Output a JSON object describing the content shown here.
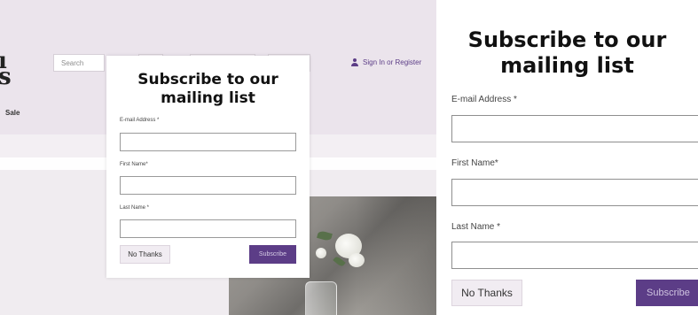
{
  "site": {
    "brand_glyphs": "ı\ns",
    "nav_sale": "Sale",
    "search_placeholder": "Search",
    "sign_in_label": "Sign In or Register"
  },
  "popup": {
    "title": "Subscribe to our mailing list",
    "email_label": "E-mail Address *",
    "email_value": "",
    "first_name_label": "First Name*",
    "first_name_value": "",
    "last_name_label": "Last Name *",
    "last_name_value": "",
    "no_thanks_label": "No Thanks",
    "subscribe_label": "Subscribe"
  },
  "zoom": {
    "title": "Subscribe to our mailing list",
    "email_label": "E-mail Address *",
    "first_name_label": "First Name*",
    "last_name_label": "Last Name *",
    "no_thanks_label": "No Thanks",
    "subscribe_label": "Subscribe"
  },
  "colors": {
    "accent": "#5c3d87",
    "header_bg": "#ebe4ec",
    "secondary_button_bg": "#f1ecf2"
  },
  "icons": {
    "account": "person-icon"
  }
}
